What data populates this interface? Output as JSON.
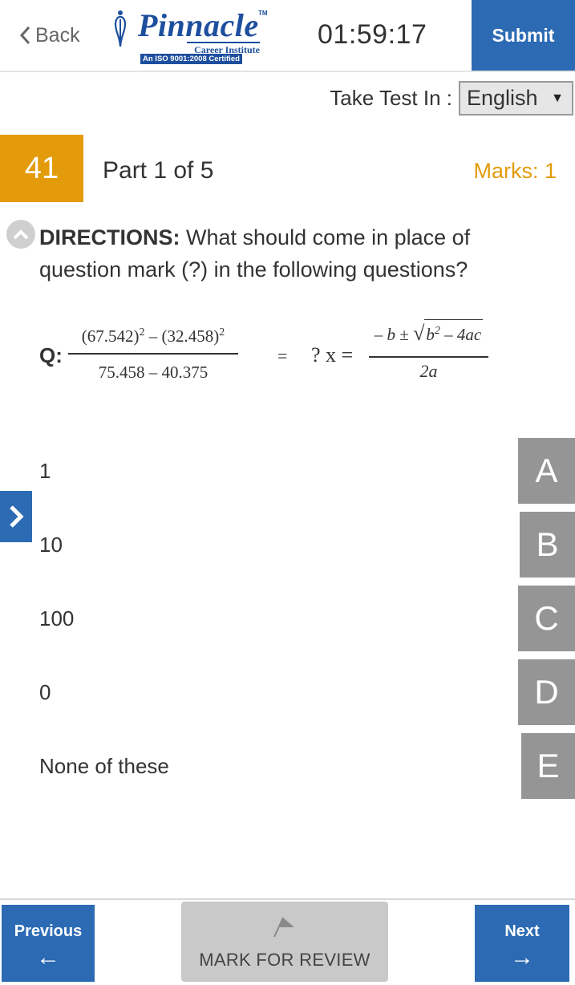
{
  "header": {
    "back_label": "Back",
    "logo": {
      "word": "Pinnacle",
      "tm": "TM",
      "subtitle": "Career Institute",
      "certification": "An ISO 9001:2008 Certified"
    },
    "timer": "01:59:17",
    "submit_label": "Submit"
  },
  "language": {
    "label": "Take Test In :",
    "selected": "English"
  },
  "question_bar": {
    "number": "41",
    "part": "Part 1 of 5",
    "marks": "Marks: 1"
  },
  "directions": {
    "heading": "DIRECTIONS:",
    "text": " What should come in place of question mark (?) in the following questions?"
  },
  "question": {
    "label": "Q:",
    "frac1": {
      "num_a": "(67.542)",
      "exp_a": "2",
      "minus": " – ",
      "num_b": "(32.458)",
      "exp_b": "2",
      "den": "75.458 – 40.375"
    },
    "equals": "=",
    "qx": "? x =",
    "frac2": {
      "num_pre": "– b ± ",
      "sqrt_b": "b",
      "sqrt_exp": "2",
      "sqrt_rest": " – 4ac",
      "den": "2a"
    }
  },
  "options": [
    {
      "letter": "A",
      "text": "1"
    },
    {
      "letter": "B",
      "text": "10"
    },
    {
      "letter": "C",
      "text": "100"
    },
    {
      "letter": "D",
      "text": "0"
    },
    {
      "letter": "E",
      "text": "None of these"
    }
  ],
  "footer": {
    "previous_label": "Previous",
    "previous_arrow": "←",
    "mark_review_label": "MARK FOR REVIEW",
    "next_label": "Next",
    "next_arrow": "→"
  },
  "colors": {
    "primary_blue": "#2c6bb4",
    "accent_orange": "#e39b0b",
    "option_grey": "#959595"
  },
  "icons": [
    "chevron-left-icon",
    "pinnacle-logo-mark",
    "chevron-up-icon",
    "chevron-right-icon",
    "flag-icon"
  ]
}
